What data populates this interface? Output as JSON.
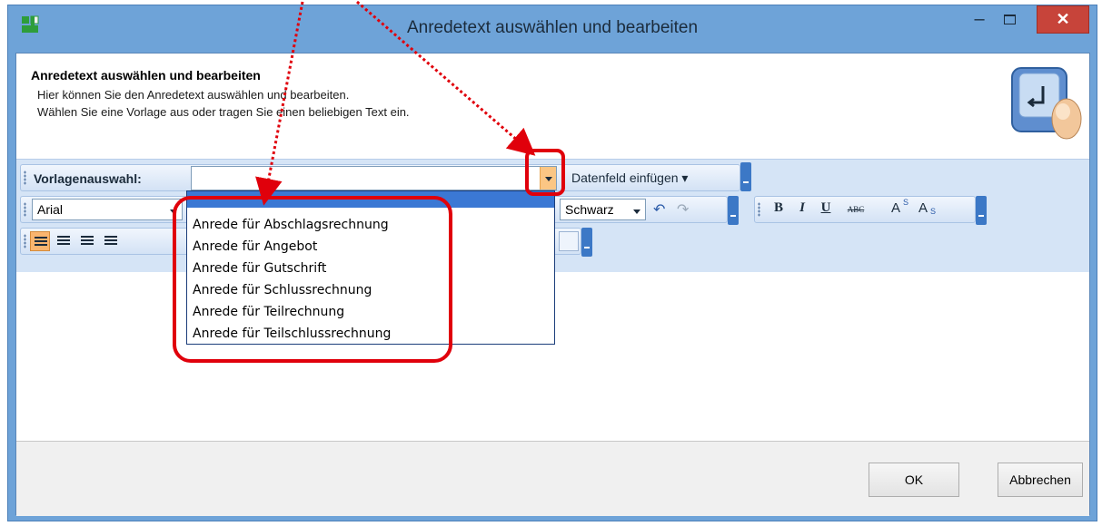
{
  "window": {
    "title": "Anredetext auswählen und bearbeiten",
    "minimize_label": "–",
    "close_label": "✕"
  },
  "header": {
    "title": "Anredetext auswählen und bearbeiten",
    "line1": "Hier können Sie den Anredetext auswählen und bearbeiten.",
    "line2": "Wählen Sie eine Vorlage aus oder tragen Sie einen beliebigen Text ein."
  },
  "toolbar1": {
    "template_label": "Vorlagenauswahl:",
    "template_value": "",
    "insert_field_label": "Datenfeld einfügen ▾"
  },
  "toolbar2": {
    "font_name": "Arial",
    "color_name": "Schwarz",
    "undo_icon": "↶",
    "redo_icon": "↷",
    "bold": "B",
    "italic": "I",
    "underline": "U",
    "strike": "ABC",
    "superscript": "A",
    "superscript_mark": "S",
    "subscript": "A",
    "subscript_mark": "S"
  },
  "dropdown": {
    "items": [
      "Anrede für Abschlagsrechnung",
      "Anrede für Angebot",
      "Anrede für Gutschrift",
      "Anrede für Schlussrechnung",
      "Anrede für Teilrechnung",
      "Anrede für Teilschlussrechnung"
    ]
  },
  "footer": {
    "ok_label": "OK",
    "cancel_label": "Abbrechen"
  },
  "colors": {
    "accent": "#6ea3d8",
    "toolbar_bg": "#d5e4f6",
    "selection": "#3b78d4",
    "highlight_orange": "#fbc684",
    "callout_red": "#e0000b"
  }
}
